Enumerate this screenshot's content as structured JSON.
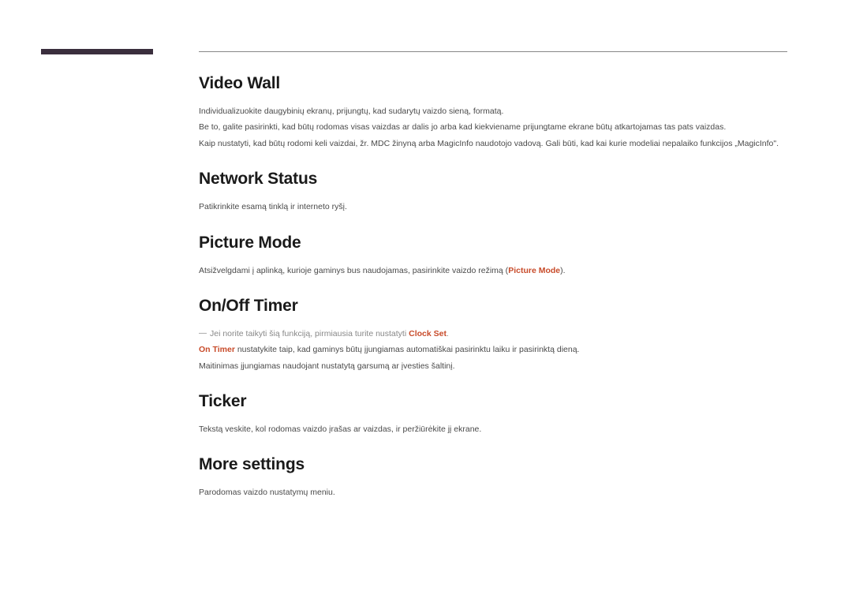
{
  "sections": {
    "videoWall": {
      "title": "Video Wall",
      "p1": "Individualizuokite daugybinių ekranų, prijungtų, kad sudarytų vaizdo sieną, formatą.",
      "p2": "Be to, galite pasirinkti, kad būtų rodomas visas vaizdas ar dalis jo arba kad kiekviename prijungtame ekrane būtų atkartojamas tas pats vaizdas.",
      "p3": "Kaip nustatyti, kad būtų rodomi keli vaizdai, žr. MDC žinyną arba MagicInfo naudotojo vadovą. Gali būti, kad kai kurie modeliai nepalaiko funkcijos „MagicInfo\"."
    },
    "networkStatus": {
      "title": "Network Status",
      "p1": "Patikrinkite esamą tinklą ir interneto ryšį."
    },
    "pictureMode": {
      "title": "Picture Mode",
      "p1_pre": "Atsižvelgdami į aplinką, kurioje gaminys bus naudojamas, pasirinkite vaizdo režimą (",
      "p1_highlight": "Picture Mode",
      "p1_post": ")."
    },
    "onOffTimer": {
      "title": "On/Off Timer",
      "note_pre": "Jei norite taikyti šią funkciją, pirmiausia turite nustatyti ",
      "note_highlight": "Clock Set",
      "note_post": ".",
      "p2_highlight": "On Timer",
      "p2_rest": " nustatykite taip, kad gaminys būtų įjungiamas automatiškai pasirinktu laiku ir pasirinktą dieną.",
      "p3": "Maitinimas įjungiamas naudojant nustatytą garsumą ar įvesties šaltinį."
    },
    "ticker": {
      "title": "Ticker",
      "p1": "Tekstą veskite, kol rodomas vaizdo įrašas ar vaizdas, ir peržiūrėkite jį ekrane."
    },
    "moreSettings": {
      "title": "More settings",
      "p1": "Parodomas vaizdo nustatymų meniu."
    }
  }
}
